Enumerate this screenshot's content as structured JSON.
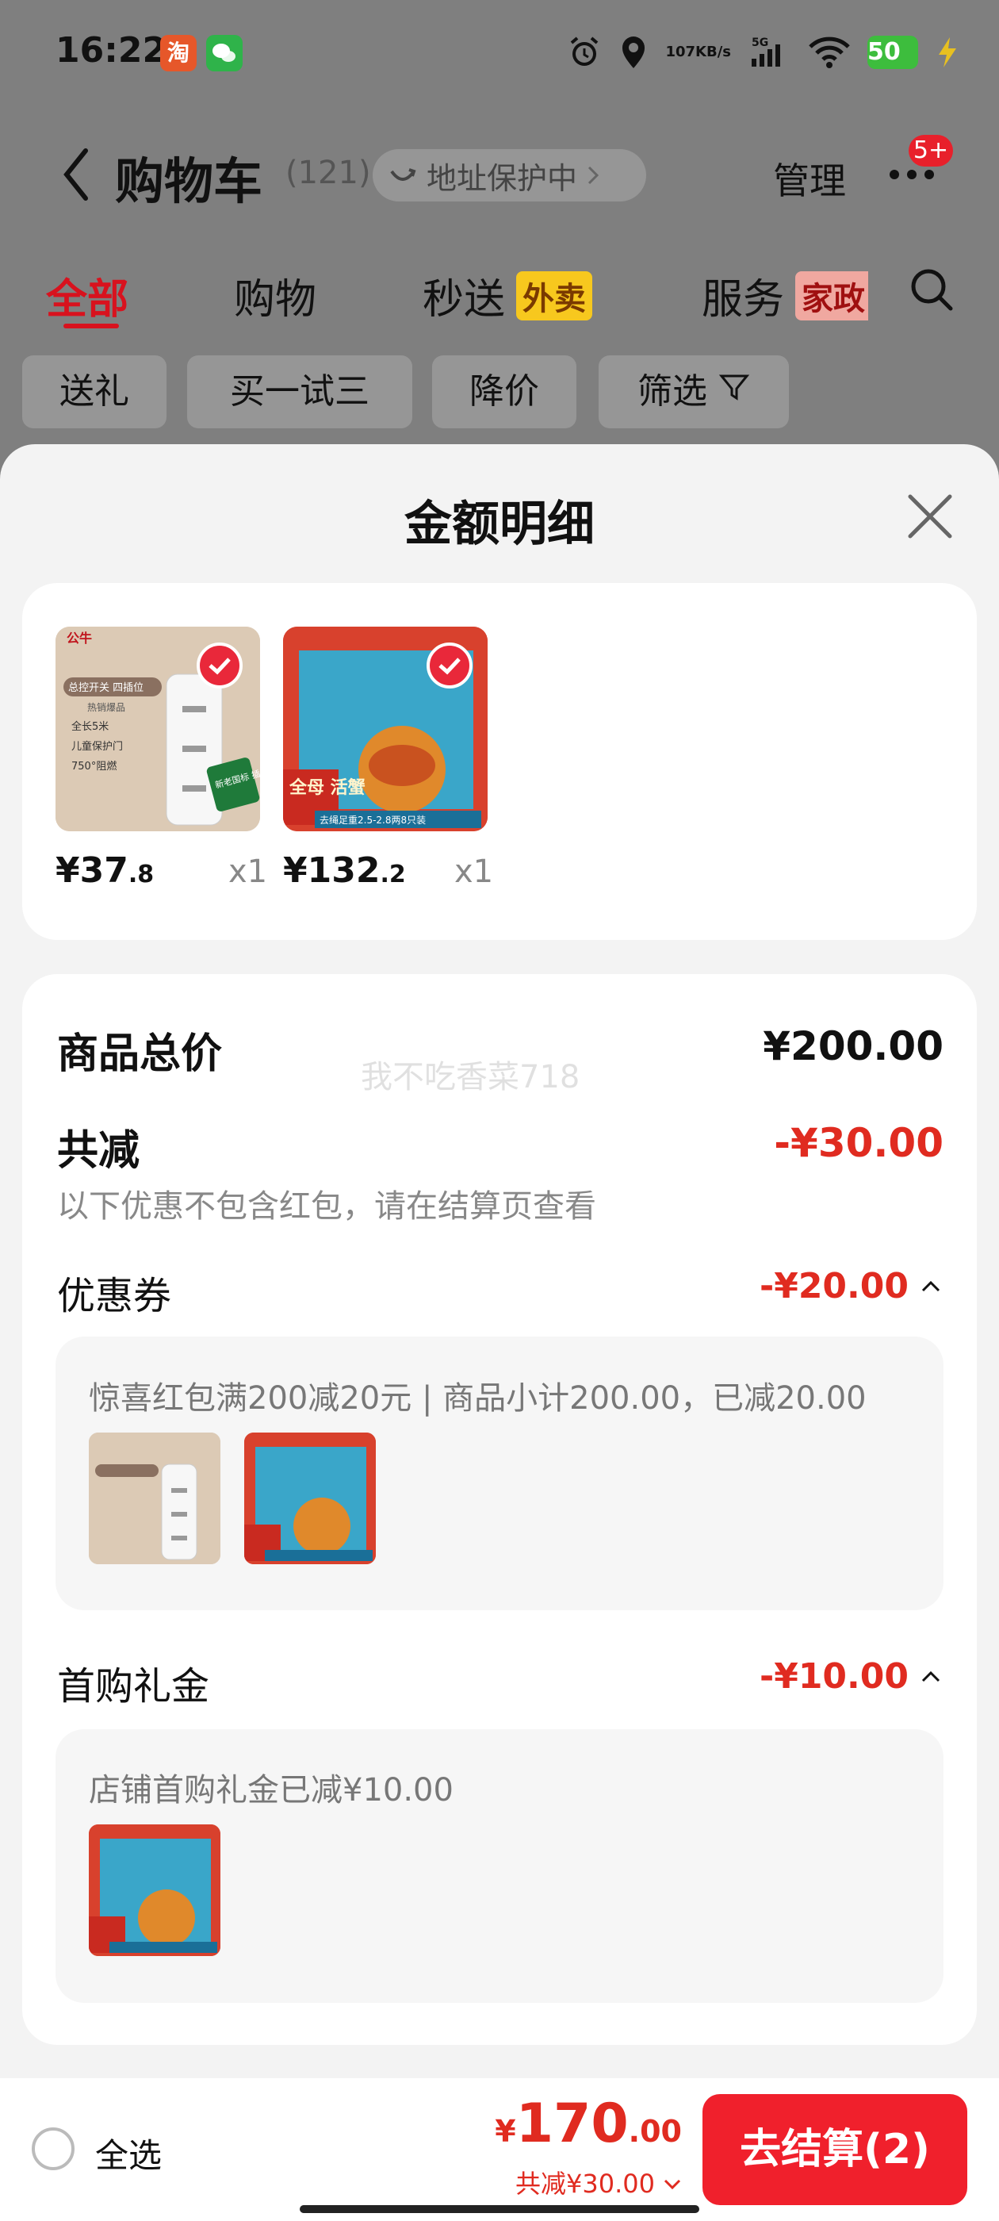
{
  "status_bar": {
    "time": "16:22",
    "app_badge_taobao": "淘",
    "net_speed_value": "107",
    "net_speed_unit": "KB/s",
    "signal_label": "5G",
    "battery": "50"
  },
  "header": {
    "title": "购物车",
    "count": "(121)",
    "address_pill": "地址保护中",
    "manage": "管理",
    "notification_badge": "5+"
  },
  "tabs": [
    {
      "label": "全部",
      "active": true
    },
    {
      "label": "购物",
      "active": false
    },
    {
      "label": "秒送",
      "active": false,
      "tag": "外卖"
    },
    {
      "label": "服务",
      "active": false,
      "tag": "家政"
    }
  ],
  "filters": [
    "送礼",
    "买一试三",
    "降价",
    "筛选"
  ],
  "sheet": {
    "title": "金额明细",
    "products": [
      {
        "price_int": "¥37",
        "price_dec": ".8",
        "qty": "x1",
        "img_text_1": "公牛",
        "img_text_2": "总控开关 四插位",
        "img_text_3": "热销爆品",
        "img_features": [
          "全长5米",
          "儿童保护门",
          "750°阻燃"
        ],
        "img_badge": "新老国标 插头适用"
      },
      {
        "price_int": "¥132",
        "price_dec": ".2",
        "qty": "x1",
        "img_text_1": "全母 活蟹",
        "img_text_2": "去绳足重2.5-2.8两8只装"
      }
    ],
    "summary": {
      "watermark": "我不吃香菜718",
      "total_label": "商品总价",
      "total_value": "¥200.00",
      "discount_label": "共减",
      "discount_value": "-¥30.00",
      "discount_note": "以下优惠不包含红包，请在结算页查看",
      "coupon_label": "优惠券",
      "coupon_value": "-¥20.00",
      "coupon_desc": "惊喜红包满200减20元 | 商品小计200.00，已减20.00",
      "gift_label": "首购礼金",
      "gift_value": "-¥10.00",
      "gift_desc": "店铺首购礼金已减¥10.00"
    }
  },
  "bottom_bar": {
    "select_all": "全选",
    "total_currency": "¥",
    "total_int": "170",
    "total_dec": ".00",
    "total_sub": "共减¥30.00",
    "checkout": "去结算(2)"
  },
  "colors": {
    "accent": "#e02b20",
    "checkout": "#f0202c",
    "overlay": "#7f7f7f"
  }
}
